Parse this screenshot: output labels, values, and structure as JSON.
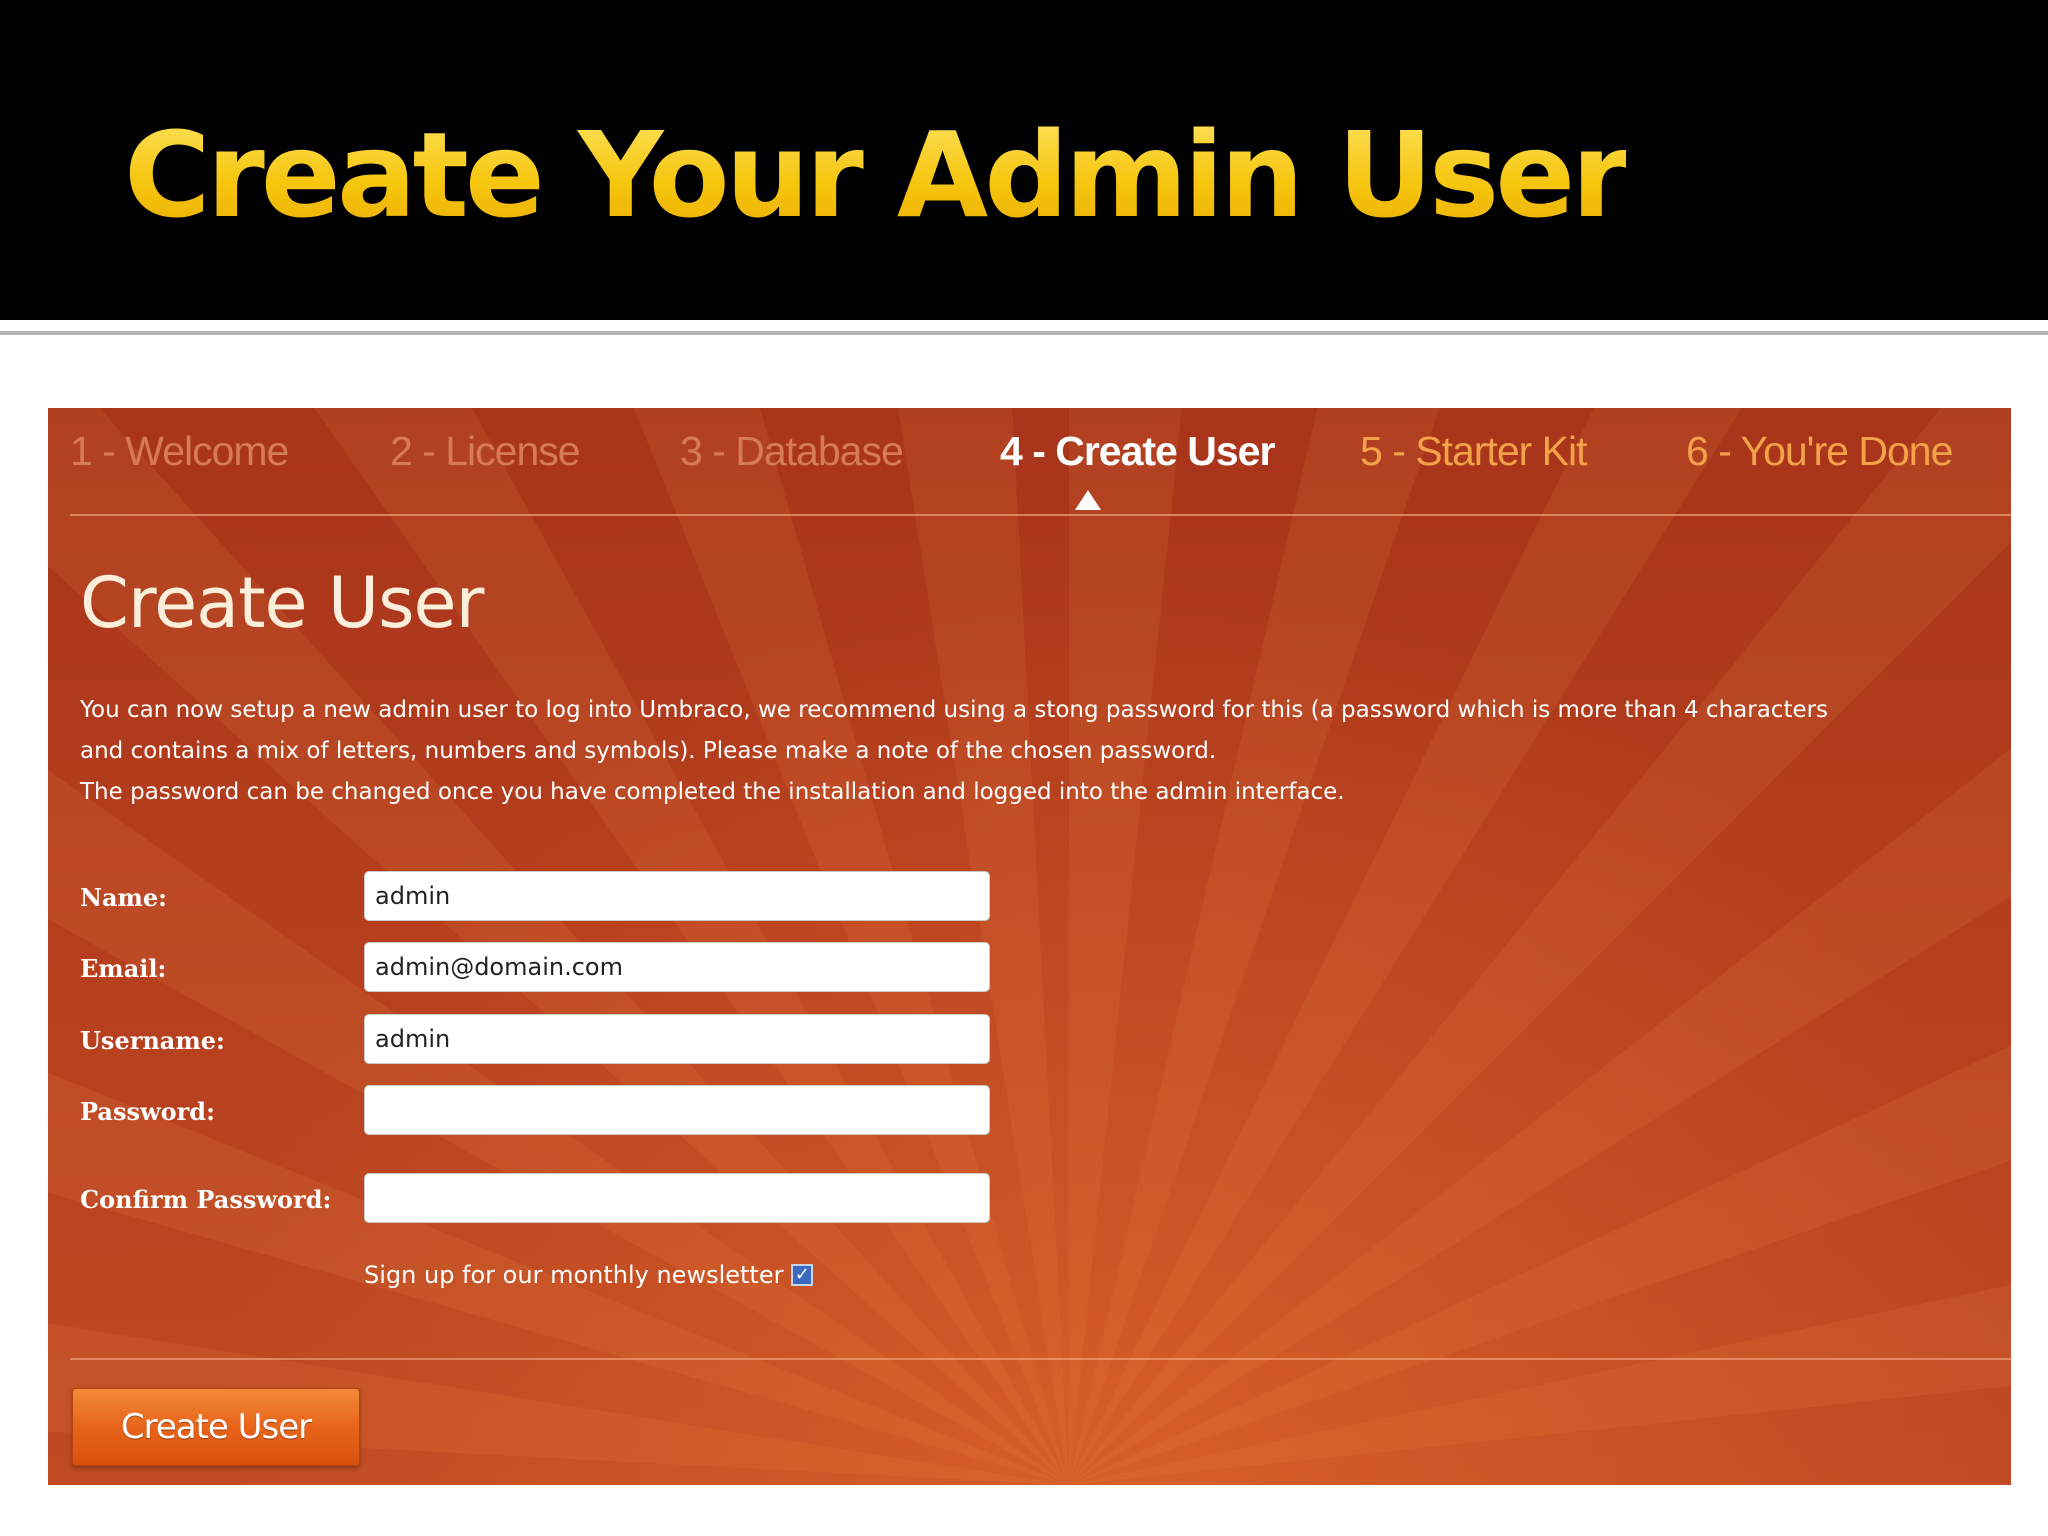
{
  "slide": {
    "title": "Create Your Admin User"
  },
  "installer": {
    "steps": [
      {
        "label": "1 - Welcome",
        "state": "done"
      },
      {
        "label": "2 - License",
        "state": "done"
      },
      {
        "label": "3 - Database",
        "state": "done"
      },
      {
        "label": "4 - Create User",
        "state": "current"
      },
      {
        "label": "5 - Starter Kit",
        "state": "upcoming"
      },
      {
        "label": "6 - You're Done",
        "state": "upcoming"
      }
    ],
    "heading": "Create User",
    "intro": [
      "You can now setup a new admin user to log into Umbraco, we recommend using a stong password for this (a password which is more than 4 characters and contains a mix of letters, numbers and symbols). Please make a note of the chosen password.",
      "The password can be changed once you have completed the installation and logged into the admin interface."
    ],
    "form": {
      "name": {
        "label": "Name:",
        "value": "admin"
      },
      "email": {
        "label": "Email:",
        "value": "admin@domain.com"
      },
      "username": {
        "label": "Username:",
        "value": "admin"
      },
      "password": {
        "label": "Password:",
        "value": ""
      },
      "confirm_password": {
        "label": "Confirm Password:",
        "value": ""
      },
      "newsletter": {
        "label": "Sign up for our monthly newsletter",
        "checked": true
      }
    },
    "submit_label": "Create User"
  },
  "colors": {
    "title": "#f6c50e",
    "panel": "#b43e1d",
    "step_done": "#d77a56",
    "step_current": "#ffffff",
    "step_upcoming": "#f3a24a",
    "button": "#e8641a"
  }
}
